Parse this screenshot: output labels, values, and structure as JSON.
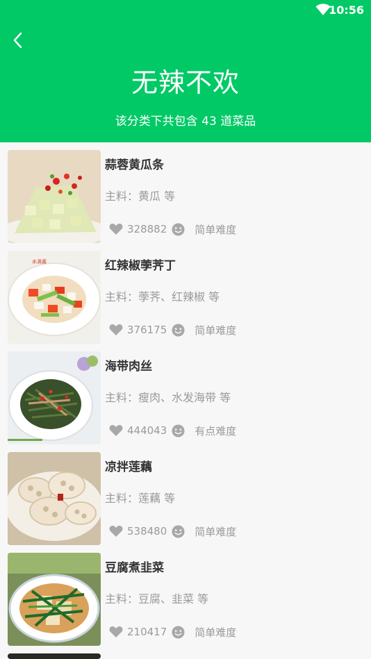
{
  "status_bar": {
    "time": "10:56",
    "wifi_icon": "wifi-icon"
  },
  "header": {
    "back_icon": "back-arrow-icon",
    "title": "无辣不欢",
    "subtitle": "该分类下共包含 43 道菜品",
    "background_color": "#00c966"
  },
  "recipes": [
    {
      "name": "蒜蓉黄瓜条",
      "ingredients": "主料：黄瓜 等",
      "likes": "328882",
      "difficulty": "简单难度"
    },
    {
      "name": "红辣椒荸荠丁",
      "ingredients": "主料：荸荠、红辣椒 等",
      "likes": "376175",
      "difficulty": "简单难度"
    },
    {
      "name": "海带肉丝",
      "ingredients": "主料：瘦肉、水发海带 等",
      "likes": "444043",
      "difficulty": "有点难度"
    },
    {
      "name": "凉拌莲藕",
      "ingredients": "主料：莲藕 等",
      "likes": "538480",
      "difficulty": "简单难度"
    },
    {
      "name": "豆腐煮韭菜",
      "ingredients": "主料：豆腐、韭菜 等",
      "likes": "210417",
      "difficulty": "简单难度"
    }
  ]
}
